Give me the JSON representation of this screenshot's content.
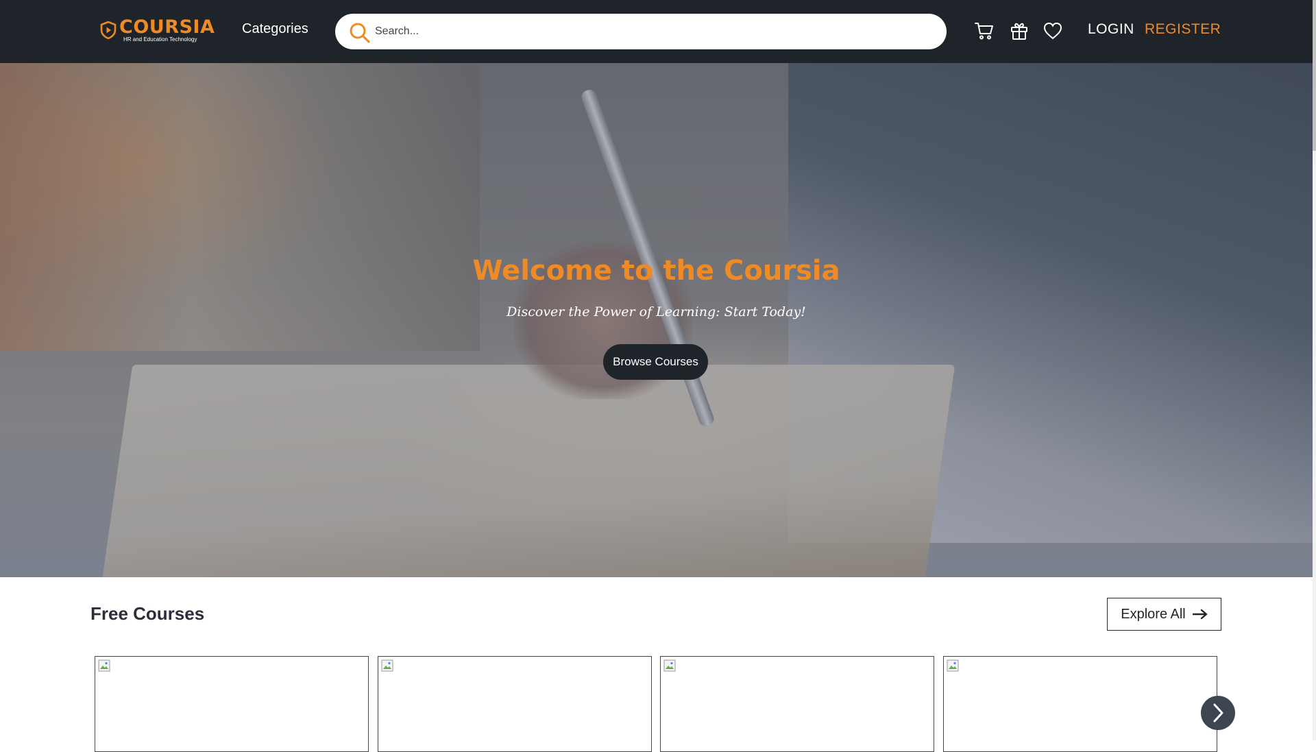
{
  "brand": {
    "name": "COURSIA",
    "tagline": "HR and Education Technology",
    "accent_color": "#f08a24",
    "navbar_color": "#1f242a"
  },
  "nav": {
    "categories_label": "Categories",
    "search_placeholder": "Search...",
    "icons": [
      "search-icon",
      "cart-icon",
      "gift-icon",
      "heart-icon"
    ],
    "login_label": "LOGIN",
    "register_label": "REGISTER"
  },
  "hero": {
    "title": "Welcome to the Coursia",
    "subtitle": "Discover the Power of Learning: Start Today!",
    "button_label": "Browse Courses"
  },
  "free_courses": {
    "title": "Free Courses",
    "explore_label": "Explore All",
    "cards": [
      {
        "image_icon": "broken-image-icon"
      },
      {
        "image_icon": "broken-image-icon"
      },
      {
        "image_icon": "broken-image-icon"
      },
      {
        "image_icon": "broken-image-icon"
      }
    ],
    "next_icon": "chevron-right-icon"
  }
}
